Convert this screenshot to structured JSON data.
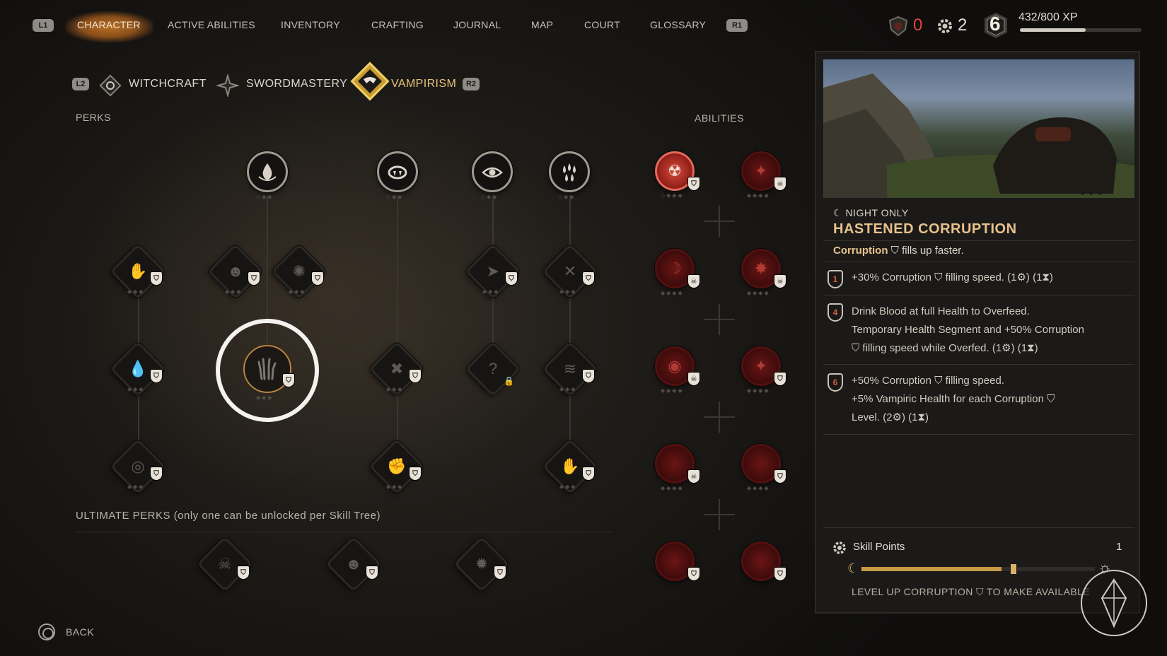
{
  "nav": {
    "left_hint": "L1",
    "right_hint": "R1",
    "tabs": [
      "CHARACTER",
      "ACTIVE ABILITIES",
      "INVENTORY",
      "CRAFTING",
      "JOURNAL",
      "MAP",
      "COURT",
      "GLOSSARY"
    ],
    "active_tab": "CHARACTER"
  },
  "resources": {
    "red_count": "0",
    "gear_count": "2",
    "level": "6",
    "xp_text": "432/800 XP",
    "xp_fraction": 0.54,
    "red_color": "#e0453a"
  },
  "subtabs": {
    "left_hint": "L2",
    "right_hint": "R2",
    "items": [
      "WITCHCRAFT",
      "SWORDMASTERY",
      "VAMPIRISM"
    ],
    "active": "VAMPIRISM"
  },
  "labels": {
    "perks": "PERKS",
    "abilities": "ABILITIES",
    "ultimate": "ULTIMATE PERKS (only one can be unlocked per Skill Tree)"
  },
  "locked_glyph": "?",
  "panel": {
    "category": "☾ NIGHT ONLY",
    "title": "HASTENED CORRUPTION",
    "summary_keyword": "Corruption",
    "summary_rest": "fills up faster.",
    "entries": [
      {
        "level": "1",
        "lines": [
          "+30% Corruption ⛉ filling speed.  (1⚙) (1⧗)"
        ]
      },
      {
        "level": "4",
        "lines": [
          "Drink Blood at full Health to Overfeed.",
          "Temporary Health Segment and +50% Corruption",
          "⛉ filling speed while Overfed.  (1⚙) (1⧗)"
        ]
      },
      {
        "level": "6",
        "lines": [
          "+50% Corruption ⛉ filling speed.",
          "+5% Vampiric Health for each Corruption ⛉",
          "Level.  (2⚙) (1⧗)"
        ]
      }
    ],
    "skill_points_label": "Skill Points",
    "skill_points_value": "1",
    "corruption_fraction": 0.6,
    "level_up_text": "LEVEL UP CORRUPTION ⛉ TO MAKE AVAILABLE"
  },
  "back": {
    "label": "BACK"
  },
  "colors": {
    "accent_gold": "#e6c18e",
    "ability_red": "#8f1d17",
    "tab_active_bg": "#b86f25"
  }
}
